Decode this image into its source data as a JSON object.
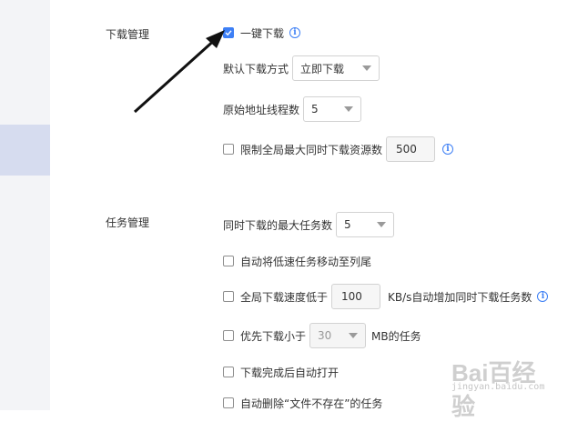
{
  "sections": {
    "download": "下载管理",
    "tasks": "任务管理"
  },
  "download": {
    "one_click": {
      "label": "一键下载",
      "checked": true
    },
    "default_method": {
      "label": "默认下载方式",
      "value": "立即下载"
    },
    "threads": {
      "label": "原始地址线程数",
      "value": "5"
    },
    "limit_resources": {
      "label": "限制全局最大同时下载资源数",
      "value": "500",
      "checked": false
    }
  },
  "tasks": {
    "max_tasks": {
      "label": "同时下载的最大任务数",
      "value": "5"
    },
    "move_slow": {
      "label": "自动将低速任务移动至列尾",
      "checked": false
    },
    "speed_below": {
      "label": "全局下载速度低于",
      "value": "100",
      "suffix": "KB/s自动增加同时下载任务数",
      "checked": false
    },
    "small_first": {
      "label": "优先下载小于",
      "value": "30",
      "suffix": "MB的任务",
      "checked": false
    },
    "auto_open": {
      "label": "下载完成后自动打开",
      "checked": false
    },
    "auto_delete": {
      "label": "自动删除“文件不存在”的任务",
      "checked": false
    }
  },
  "icons": {
    "info": "info-icon",
    "check": "checkmark-icon",
    "dropdown": "chevron-down-icon"
  },
  "colors": {
    "accent": "#3d7ff5",
    "sidebar": "#f3f4f7",
    "sidebar_active": "#d6dcef"
  },
  "watermark": {
    "logo": "Bai百经验",
    "url": "jingyan.baidu.com"
  }
}
